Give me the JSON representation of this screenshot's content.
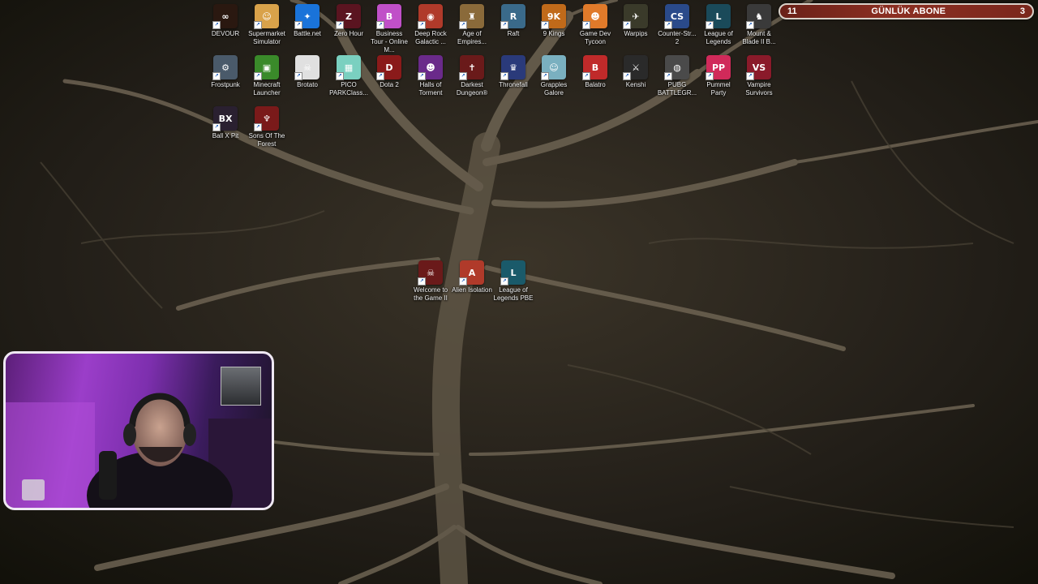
{
  "desktop": {
    "icons": [
      {
        "label": "DEVOUR",
        "color": "#2a1810",
        "glyph": "∞"
      },
      {
        "label": "Supermarket Simulator",
        "color": "#d9a24a",
        "glyph": "☺"
      },
      {
        "label": "Battle.net",
        "color": "#1a73d9",
        "glyph": "✦"
      },
      {
        "label": "Zero Hour",
        "color": "#5a1420",
        "glyph": "Z"
      },
      {
        "label": "Business Tour - Online M...",
        "color": "#c050c8",
        "glyph": "B"
      },
      {
        "label": "Deep Rock Galactic ...",
        "color": "#b03a2a",
        "glyph": "◉"
      },
      {
        "label": "Age of Empires...",
        "color": "#8a6a3a",
        "glyph": "♜"
      },
      {
        "label": "Raft",
        "color": "#3a6a8a",
        "glyph": "R"
      },
      {
        "label": "9 Kings",
        "color": "#c06a1a",
        "glyph": "9K"
      },
      {
        "label": "Game Dev Tycoon",
        "color": "#e07a2a",
        "glyph": "☻"
      },
      {
        "label": "Warpips",
        "color": "#3a3a2a",
        "glyph": "✈"
      },
      {
        "label": "Counter-Str... 2",
        "color": "#2a4a8a",
        "glyph": "CS"
      },
      {
        "label": "League of Legends",
        "color": "#1a4a5a",
        "glyph": "L"
      },
      {
        "label": "Mount & Blade II B...",
        "color": "#3a3a3a",
        "glyph": "♞"
      },
      {
        "label": "Frostpunk",
        "color": "#4a5a6a",
        "glyph": "⚙"
      },
      {
        "label": "Minecraft Launcher",
        "color": "#3a8a2a",
        "glyph": "▣"
      },
      {
        "label": "Brotato",
        "color": "#e0e0e0",
        "glyph": "☠"
      },
      {
        "label": "PICO PARKClass...",
        "color": "#7ad0c0",
        "glyph": "▦"
      },
      {
        "label": "Dota 2",
        "color": "#8a1a1a",
        "glyph": "D"
      },
      {
        "label": "Halls of Torment",
        "color": "#6a2a8a",
        "glyph": "☻"
      },
      {
        "label": "Darkest Dungeon®",
        "color": "#6a1a1a",
        "glyph": "✝"
      },
      {
        "label": "Thronefall",
        "color": "#2a3a7a",
        "glyph": "♛"
      },
      {
        "label": "Grapples Galore",
        "color": "#7ab0c0",
        "glyph": "☺"
      },
      {
        "label": "Balatro",
        "color": "#c02a2a",
        "glyph": "B"
      },
      {
        "label": "Kenshi",
        "color": "#2a2a2a",
        "glyph": "⚔"
      },
      {
        "label": "PUBG BATTLEGR...",
        "color": "#4a4a4a",
        "glyph": "◍"
      },
      {
        "label": "Pummel Party",
        "color": "#d02a5a",
        "glyph": "PP"
      },
      {
        "label": "Vampire Survivors",
        "color": "#8a1a2a",
        "glyph": "VS"
      },
      {
        "label": "Ball X Pit",
        "color": "#2a2030",
        "glyph": "BX"
      },
      {
        "label": "Sons Of The Forest",
        "color": "#7a1a1a",
        "glyph": "♆"
      },
      {
        "label": "Welcome to the Game II",
        "color": "#6a1a1a",
        "glyph": "☠"
      },
      {
        "label": "Alien Isolation",
        "color": "#b03a2a",
        "glyph": "A"
      },
      {
        "label": "League of Legends PBE",
        "color": "#1a5a6a",
        "glyph": "L"
      }
    ],
    "shortcut_arrow": "↗"
  },
  "goal_bar": {
    "current": "11",
    "title": "GÜNLÜK ABONE",
    "target": "3"
  },
  "webcam": {
    "label": "webcam overlay"
  }
}
